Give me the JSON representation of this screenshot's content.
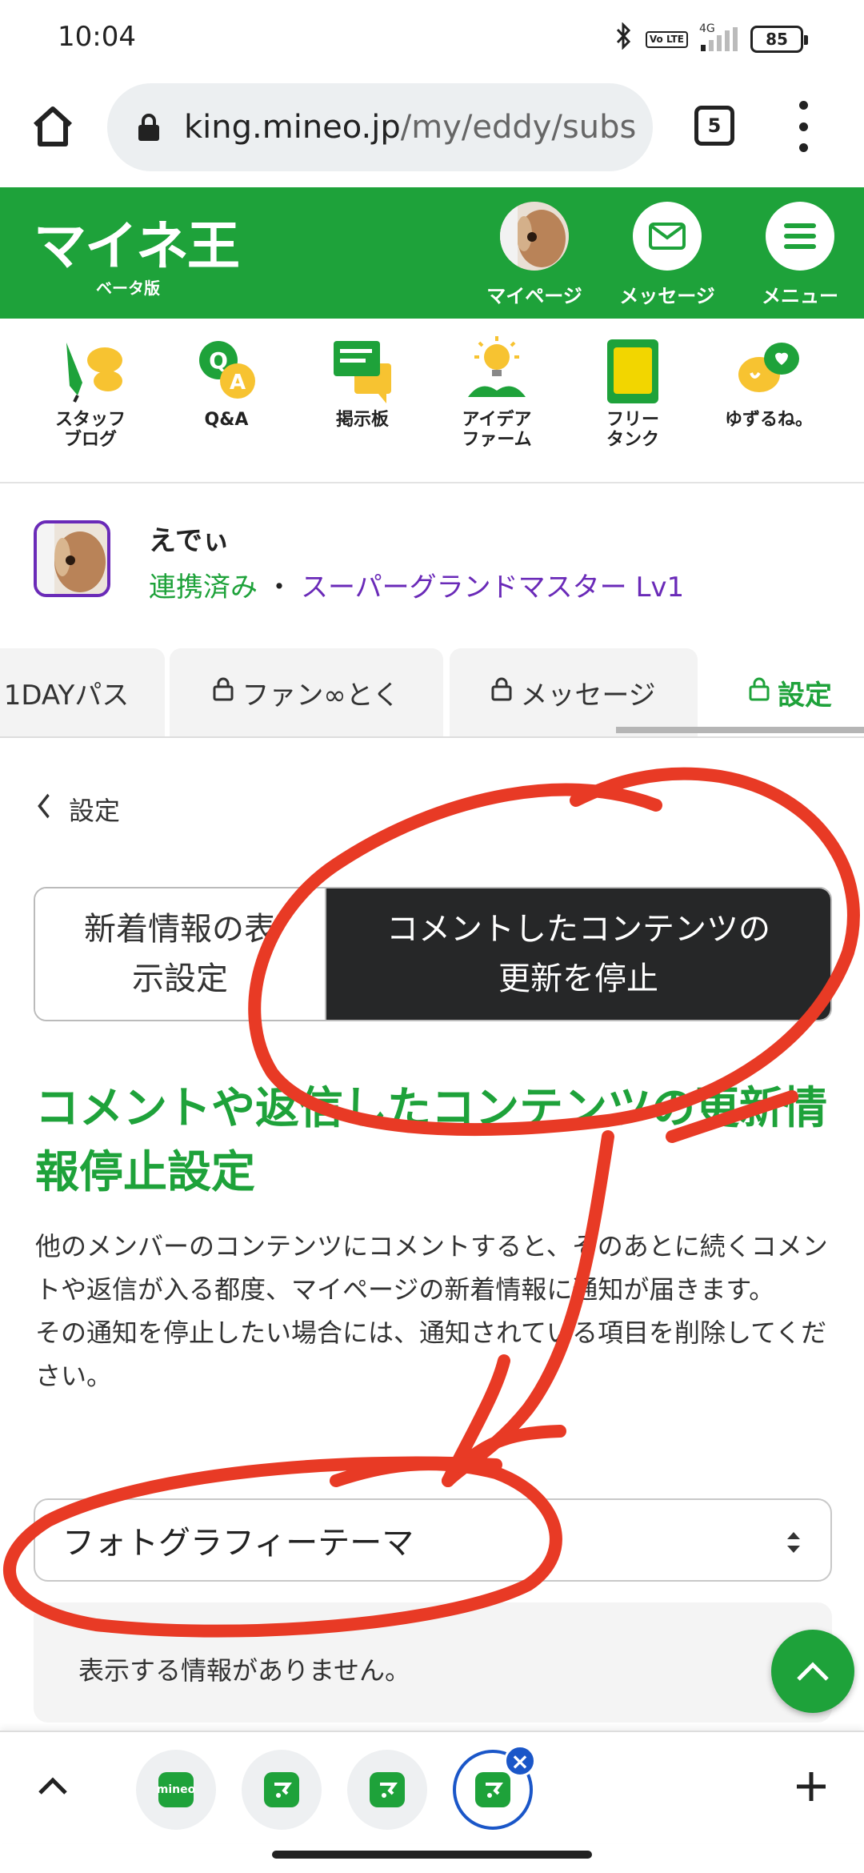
{
  "status_bar": {
    "time": "10:04",
    "battery": "85",
    "network": "4G",
    "volte": "Vo LTE"
  },
  "browser": {
    "url_host": "king.mineo.jp",
    "url_path": "/my/eddy/subs",
    "tab_count": "5"
  },
  "site_header": {
    "logo": "マイネ王",
    "logo_sub": "ベータ版",
    "nav": [
      {
        "label": "マイページ",
        "icon": "avatar"
      },
      {
        "label": "メッセージ",
        "icon": "mail-icon"
      },
      {
        "label": "メニュー",
        "icon": "hamburger-icon"
      }
    ]
  },
  "icon_nav": [
    {
      "label_line1": "スタッフ",
      "label_line2": "ブログ",
      "icon": "staff-blog-icon"
    },
    {
      "label_line1": "Q&A",
      "label_line2": "",
      "icon": "qa-icon"
    },
    {
      "label_line1": "掲示板",
      "label_line2": "",
      "icon": "board-icon"
    },
    {
      "label_line1": "アイデア",
      "label_line2": "ファーム",
      "icon": "idea-farm-icon"
    },
    {
      "label_line1": "フリー",
      "label_line2": "タンク",
      "icon": "free-tank-icon"
    },
    {
      "label_line1": "ゆずるね。",
      "label_line2": "",
      "icon": "yuzurune-icon"
    }
  ],
  "profile": {
    "name": "えでぃ",
    "linked": "連携済み",
    "separator": "・",
    "rank": "スーパーグランドマスター Lv1"
  },
  "tabs": [
    {
      "label": "1DAYパス",
      "locked": false,
      "active": false
    },
    {
      "label": "ファン∞とく",
      "locked": true,
      "active": false
    },
    {
      "label": "メッセージ",
      "locked": true,
      "active": false
    },
    {
      "label": "設定",
      "locked": true,
      "active": true
    }
  ],
  "content": {
    "back_label": "設定",
    "segment": {
      "inactive_line1": "新着情報の表",
      "inactive_line2": "示設定",
      "active_line1": "コメントしたコンテンツの",
      "active_line2": "更新を停止"
    },
    "title": "コメントや返信したコンテンツの更新情報停止設定",
    "desc_line1": "他のメンバーのコンテンツにコメントすると、そのあとに続くコメントや返信が入る都度、マイページの新着情報に通知が届きます。",
    "desc_line2": "その通知を停止したい場合には、通知されている項目を削除してください。",
    "select_value": "フォトグラフィーテーマ",
    "empty_message": "表示する情報がありません。"
  },
  "bottom_tabs": {
    "tab1_label": "mineo"
  },
  "colors": {
    "brand_green": "#1ea23a",
    "rank_purple": "#6a2ab8",
    "segment_dark": "#262728",
    "annotation_red": "#e83a25",
    "tab_active_blue": "#1a56c8"
  }
}
